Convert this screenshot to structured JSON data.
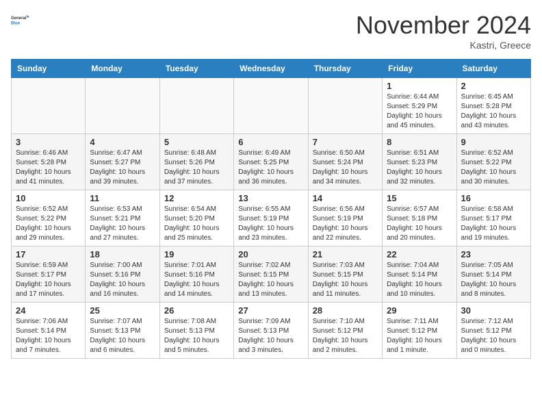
{
  "header": {
    "logo_general": "General",
    "logo_blue": "Blue",
    "month_title": "November 2024",
    "location": "Kastri, Greece"
  },
  "weekdays": [
    "Sunday",
    "Monday",
    "Tuesday",
    "Wednesday",
    "Thursday",
    "Friday",
    "Saturday"
  ],
  "weeks": [
    [
      {
        "day": "",
        "info": ""
      },
      {
        "day": "",
        "info": ""
      },
      {
        "day": "",
        "info": ""
      },
      {
        "day": "",
        "info": ""
      },
      {
        "day": "",
        "info": ""
      },
      {
        "day": "1",
        "info": "Sunrise: 6:44 AM\nSunset: 5:29 PM\nDaylight: 10 hours\nand 45 minutes."
      },
      {
        "day": "2",
        "info": "Sunrise: 6:45 AM\nSunset: 5:28 PM\nDaylight: 10 hours\nand 43 minutes."
      }
    ],
    [
      {
        "day": "3",
        "info": "Sunrise: 6:46 AM\nSunset: 5:28 PM\nDaylight: 10 hours\nand 41 minutes."
      },
      {
        "day": "4",
        "info": "Sunrise: 6:47 AM\nSunset: 5:27 PM\nDaylight: 10 hours\nand 39 minutes."
      },
      {
        "day": "5",
        "info": "Sunrise: 6:48 AM\nSunset: 5:26 PM\nDaylight: 10 hours\nand 37 minutes."
      },
      {
        "day": "6",
        "info": "Sunrise: 6:49 AM\nSunset: 5:25 PM\nDaylight: 10 hours\nand 36 minutes."
      },
      {
        "day": "7",
        "info": "Sunrise: 6:50 AM\nSunset: 5:24 PM\nDaylight: 10 hours\nand 34 minutes."
      },
      {
        "day": "8",
        "info": "Sunrise: 6:51 AM\nSunset: 5:23 PM\nDaylight: 10 hours\nand 32 minutes."
      },
      {
        "day": "9",
        "info": "Sunrise: 6:52 AM\nSunset: 5:22 PM\nDaylight: 10 hours\nand 30 minutes."
      }
    ],
    [
      {
        "day": "10",
        "info": "Sunrise: 6:52 AM\nSunset: 5:22 PM\nDaylight: 10 hours\nand 29 minutes."
      },
      {
        "day": "11",
        "info": "Sunrise: 6:53 AM\nSunset: 5:21 PM\nDaylight: 10 hours\nand 27 minutes."
      },
      {
        "day": "12",
        "info": "Sunrise: 6:54 AM\nSunset: 5:20 PM\nDaylight: 10 hours\nand 25 minutes."
      },
      {
        "day": "13",
        "info": "Sunrise: 6:55 AM\nSunset: 5:19 PM\nDaylight: 10 hours\nand 23 minutes."
      },
      {
        "day": "14",
        "info": "Sunrise: 6:56 AM\nSunset: 5:19 PM\nDaylight: 10 hours\nand 22 minutes."
      },
      {
        "day": "15",
        "info": "Sunrise: 6:57 AM\nSunset: 5:18 PM\nDaylight: 10 hours\nand 20 minutes."
      },
      {
        "day": "16",
        "info": "Sunrise: 6:58 AM\nSunset: 5:17 PM\nDaylight: 10 hours\nand 19 minutes."
      }
    ],
    [
      {
        "day": "17",
        "info": "Sunrise: 6:59 AM\nSunset: 5:17 PM\nDaylight: 10 hours\nand 17 minutes."
      },
      {
        "day": "18",
        "info": "Sunrise: 7:00 AM\nSunset: 5:16 PM\nDaylight: 10 hours\nand 16 minutes."
      },
      {
        "day": "19",
        "info": "Sunrise: 7:01 AM\nSunset: 5:16 PM\nDaylight: 10 hours\nand 14 minutes."
      },
      {
        "day": "20",
        "info": "Sunrise: 7:02 AM\nSunset: 5:15 PM\nDaylight: 10 hours\nand 13 minutes."
      },
      {
        "day": "21",
        "info": "Sunrise: 7:03 AM\nSunset: 5:15 PM\nDaylight: 10 hours\nand 11 minutes."
      },
      {
        "day": "22",
        "info": "Sunrise: 7:04 AM\nSunset: 5:14 PM\nDaylight: 10 hours\nand 10 minutes."
      },
      {
        "day": "23",
        "info": "Sunrise: 7:05 AM\nSunset: 5:14 PM\nDaylight: 10 hours\nand 8 minutes."
      }
    ],
    [
      {
        "day": "24",
        "info": "Sunrise: 7:06 AM\nSunset: 5:14 PM\nDaylight: 10 hours\nand 7 minutes."
      },
      {
        "day": "25",
        "info": "Sunrise: 7:07 AM\nSunset: 5:13 PM\nDaylight: 10 hours\nand 6 minutes."
      },
      {
        "day": "26",
        "info": "Sunrise: 7:08 AM\nSunset: 5:13 PM\nDaylight: 10 hours\nand 5 minutes."
      },
      {
        "day": "27",
        "info": "Sunrise: 7:09 AM\nSunset: 5:13 PM\nDaylight: 10 hours\nand 3 minutes."
      },
      {
        "day": "28",
        "info": "Sunrise: 7:10 AM\nSunset: 5:12 PM\nDaylight: 10 hours\nand 2 minutes."
      },
      {
        "day": "29",
        "info": "Sunrise: 7:11 AM\nSunset: 5:12 PM\nDaylight: 10 hours\nand 1 minute."
      },
      {
        "day": "30",
        "info": "Sunrise: 7:12 AM\nSunset: 5:12 PM\nDaylight: 10 hours\nand 0 minutes."
      }
    ]
  ]
}
